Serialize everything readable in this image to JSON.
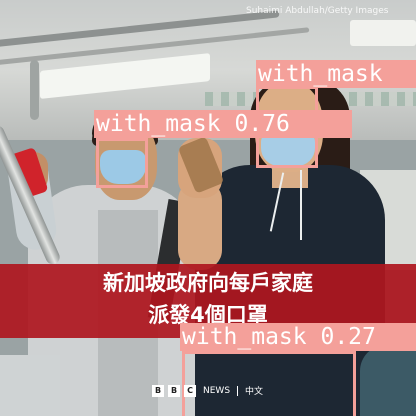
{
  "image": {
    "credit": "Suhaimi Abdullah/Getty Images",
    "caption": [
      "新加坡政府向每戶家庭",
      "派發4個口罩"
    ],
    "logo": {
      "letters": [
        "B",
        "B",
        "C"
      ],
      "news": "NEWS",
      "lang": "中文"
    }
  },
  "detections": [
    {
      "label": "with_mask",
      "score": "0.76"
    },
    {
      "label": "with_mask",
      "score": ""
    },
    {
      "label": "with_mask",
      "score": "0.27"
    }
  ],
  "colors": {
    "box": "#f4a09a",
    "banner": "#af161e"
  }
}
